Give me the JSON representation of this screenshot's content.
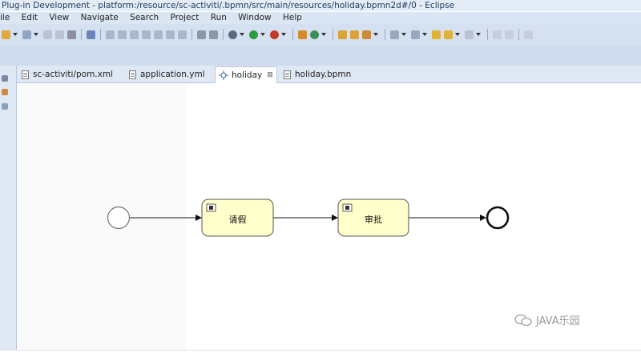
{
  "window": {
    "title": "Plug-in Development - platform:/resource/sc-activiti/.bpmn/src/main/resources/holiday.bpmn2d#/0 - Eclipse"
  },
  "menu": {
    "items": [
      "ile",
      "Edit",
      "View",
      "Navigate",
      "Search",
      "Project",
      "Run",
      "Window",
      "Help"
    ]
  },
  "tabs": [
    {
      "label": "sc-activiti/pom.xml",
      "icon": "xml-file-icon"
    },
    {
      "label": "application.yml",
      "icon": "file-icon"
    },
    {
      "label": "holiday",
      "icon": "bpmn-diagram-icon",
      "active": true,
      "close": "⊠"
    },
    {
      "label": "holiday.bpmn",
      "icon": "file-icon"
    }
  ],
  "diagram": {
    "start_event": "start-event",
    "tasks": [
      {
        "label": "请假",
        "fill": "#ffffcc"
      },
      {
        "label": "审批",
        "fill": "#ffffcc"
      }
    ],
    "end_event": "end-event"
  },
  "watermark": {
    "text": "JAVA乐园"
  },
  "colors": {
    "titlebar": "#e3ecf7",
    "toolbar": "#d5e1f1",
    "task_fill": "#ffffcc",
    "task_border": "#555555"
  }
}
